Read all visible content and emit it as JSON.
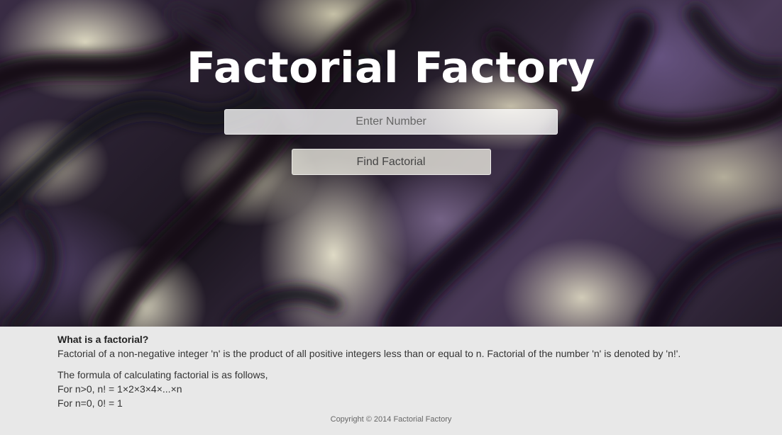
{
  "hero": {
    "title": "Factorial Factory",
    "input_placeholder": "Enter Number",
    "button_label": "Find Factorial"
  },
  "info": {
    "heading": "What is a factorial?",
    "definition": "Factorial of a non-negative integer 'n' is the product of all positive integers less than or equal to n. Factorial of the number 'n' is denoted by 'n!'.",
    "formula_intro": "The formula of calculating factorial is as follows,",
    "formula_case1": "For n>0, n! = 1×2×3×4×...×n",
    "formula_case2": "For n=0, 0! = 1"
  },
  "footer": {
    "copyright": "Copyright © 2014 Factorial Factory"
  }
}
